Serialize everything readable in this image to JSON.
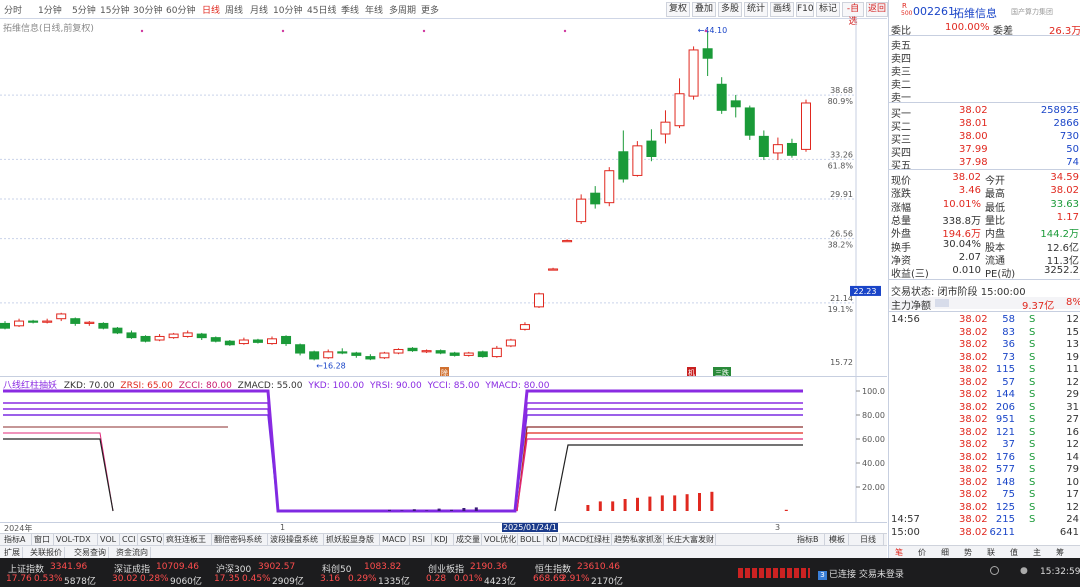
{
  "periods": [
    "分时",
    "1分钟",
    "5分钟",
    "15分钟",
    "30分钟",
    "60分钟",
    "日线",
    "周线",
    "月线",
    "10分钟",
    "45日线",
    "季线",
    "年线",
    "多周期",
    "更多"
  ],
  "active_period": "日线",
  "toolbar": [
    "复权",
    "叠加",
    "多股",
    "统计",
    "画线",
    "F10",
    "标记",
    "-自选",
    "返回"
  ],
  "chart": {
    "title": "拓维信息(日线,前复权)",
    "price_ticks": [
      "38.68",
      "33.26",
      "29.91",
      "26.56",
      "22.23",
      "21.14",
      "15.72"
    ],
    "pct_ticks": [
      "80.9%",
      "61.8%",
      "38.2%",
      "19.1%"
    ],
    "high_label": "44.10",
    "low_label": "16.28",
    "markers": [
      "除",
      "机",
      "三跌"
    ],
    "candles": [
      {
        "o": 19.4,
        "c": 19.0,
        "h": 19.6,
        "l": 18.9
      },
      {
        "o": 19.2,
        "c": 19.6,
        "h": 19.8,
        "l": 19.1
      },
      {
        "o": 19.6,
        "c": 19.5,
        "h": 19.7,
        "l": 19.4
      },
      {
        "o": 19.5,
        "c": 19.6,
        "h": 19.8,
        "l": 19.4
      },
      {
        "o": 19.8,
        "c": 20.2,
        "h": 20.3,
        "l": 19.6
      },
      {
        "o": 19.8,
        "c": 19.4,
        "h": 19.9,
        "l": 19.2
      },
      {
        "o": 19.4,
        "c": 19.5,
        "h": 19.6,
        "l": 19.2
      },
      {
        "o": 19.4,
        "c": 19.0,
        "h": 19.5,
        "l": 18.9
      },
      {
        "o": 19.0,
        "c": 18.6,
        "h": 19.1,
        "l": 18.5
      },
      {
        "o": 18.6,
        "c": 18.2,
        "h": 18.8,
        "l": 18.1
      },
      {
        "o": 18.3,
        "c": 17.9,
        "h": 18.4,
        "l": 17.8
      },
      {
        "o": 18.0,
        "c": 18.3,
        "h": 18.5,
        "l": 17.9
      },
      {
        "o": 18.2,
        "c": 18.5,
        "h": 18.6,
        "l": 18.1
      },
      {
        "o": 18.3,
        "c": 18.6,
        "h": 18.8,
        "l": 18.2
      },
      {
        "o": 18.5,
        "c": 18.2,
        "h": 18.6,
        "l": 18.0
      },
      {
        "o": 18.2,
        "c": 17.9,
        "h": 18.3,
        "l": 17.8
      },
      {
        "o": 17.9,
        "c": 17.6,
        "h": 18.0,
        "l": 17.5
      },
      {
        "o": 17.7,
        "c": 18.0,
        "h": 18.2,
        "l": 17.6
      },
      {
        "o": 18.0,
        "c": 17.8,
        "h": 18.1,
        "l": 17.7
      },
      {
        "o": 17.7,
        "c": 18.1,
        "h": 18.3,
        "l": 17.6
      },
      {
        "o": 18.3,
        "c": 17.7,
        "h": 18.4,
        "l": 17.5
      },
      {
        "o": 17.6,
        "c": 16.9,
        "h": 17.7,
        "l": 16.7
      },
      {
        "o": 17.0,
        "c": 16.4,
        "h": 17.1,
        "l": 16.28
      },
      {
        "o": 16.5,
        "c": 17.0,
        "h": 17.2,
        "l": 16.4
      },
      {
        "o": 17.0,
        "c": 16.9,
        "h": 17.3,
        "l": 16.8
      },
      {
        "o": 16.9,
        "c": 16.7,
        "h": 17.0,
        "l": 16.5
      },
      {
        "o": 16.6,
        "c": 16.4,
        "h": 16.8,
        "l": 16.3
      },
      {
        "o": 16.5,
        "c": 16.9,
        "h": 17.0,
        "l": 16.4
      },
      {
        "o": 16.9,
        "c": 17.2,
        "h": 17.3,
        "l": 16.8
      },
      {
        "o": 17.3,
        "c": 17.1,
        "h": 17.4,
        "l": 17.0
      },
      {
        "o": 17.0,
        "c": 17.1,
        "h": 17.2,
        "l": 16.9
      },
      {
        "o": 17.1,
        "c": 16.9,
        "h": 17.2,
        "l": 16.8
      },
      {
        "o": 16.9,
        "c": 16.7,
        "h": 17.0,
        "l": 16.6
      },
      {
        "o": 16.7,
        "c": 16.9,
        "h": 17.0,
        "l": 16.6
      },
      {
        "o": 17.0,
        "c": 16.6,
        "h": 17.1,
        "l": 16.5
      },
      {
        "o": 16.6,
        "c": 17.3,
        "h": 17.5,
        "l": 16.5
      },
      {
        "o": 17.5,
        "c": 18.0,
        "h": 18.1,
        "l": 17.4
      },
      {
        "o": 18.9,
        "c": 19.3,
        "h": 19.5,
        "l": 18.8
      },
      {
        "o": 20.8,
        "c": 21.9,
        "h": 22.0,
        "l": 20.7
      },
      {
        "o": 23.9,
        "c": 24.0,
        "h": 24.1,
        "l": 23.9
      },
      {
        "o": 26.3,
        "c": 26.4,
        "h": 26.5,
        "l": 26.3
      },
      {
        "o": 28.0,
        "c": 29.9,
        "h": 30.3,
        "l": 27.8
      },
      {
        "o": 30.4,
        "c": 29.5,
        "h": 31.0,
        "l": 29.1
      },
      {
        "o": 29.6,
        "c": 32.3,
        "h": 32.6,
        "l": 29.3
      },
      {
        "o": 33.9,
        "c": 31.6,
        "h": 35.7,
        "l": 31.3
      },
      {
        "o": 31.9,
        "c": 34.4,
        "h": 34.8,
        "l": 31.8
      },
      {
        "o": 34.8,
        "c": 33.5,
        "h": 35.8,
        "l": 33.1
      },
      {
        "o": 35.4,
        "c": 36.4,
        "h": 37.4,
        "l": 34.6
      },
      {
        "o": 36.1,
        "c": 38.8,
        "h": 40.1,
        "l": 35.9
      },
      {
        "o": 38.6,
        "c": 42.5,
        "h": 42.8,
        "l": 38.3
      },
      {
        "o": 42.6,
        "c": 41.8,
        "h": 44.1,
        "l": 40.3
      },
      {
        "o": 39.6,
        "c": 37.4,
        "h": 40.2,
        "l": 37.1
      },
      {
        "o": 38.2,
        "c": 37.7,
        "h": 38.7,
        "l": 36.8
      },
      {
        "o": 37.6,
        "c": 35.3,
        "h": 37.8,
        "l": 34.9
      },
      {
        "o": 35.2,
        "c": 33.5,
        "h": 35.7,
        "l": 33.2
      },
      {
        "o": 33.8,
        "c": 34.5,
        "h": 35.1,
        "l": 33.2
      },
      {
        "o": 34.6,
        "c": 33.6,
        "h": 35.0,
        "l": 33.4
      },
      {
        "o": 34.1,
        "c": 38.02,
        "h": 38.3,
        "l": 33.9
      }
    ]
  },
  "sub": {
    "title_name": "八线红柱抽妖",
    "params": [
      "ZKD: 70.00",
      "ZRSI: 65.00",
      "ZCCI: 80.00",
      "ZMACD: 55.00",
      "YKD: 100.00",
      "YRSI: 90.00",
      "YCCI: 85.00",
      "YMACD: 80.00"
    ],
    "ticks": [
      "100.0",
      "80.00",
      "60.00",
      "40.00",
      "20.00"
    ],
    "bars": [
      1,
      0.5,
      1.5,
      0.5,
      2,
      1,
      2.5,
      3,
      0,
      0,
      0,
      0,
      0,
      0,
      0,
      0,
      5,
      8,
      8,
      10,
      11,
      12,
      13,
      13,
      14,
      15,
      16,
      0,
      0,
      0,
      0,
      0,
      1
    ]
  },
  "dates": [
    "2024年",
    "1",
    "2025/01/24/1",
    "3"
  ],
  "ind_tabs": [
    "指标A",
    "窗口",
    "VOL-TDX",
    "VOL",
    "CCI",
    "GSTQ",
    "疯狂连板王",
    "翻倍密码系统",
    "波段操盘系统",
    "抓妖股显身版",
    "MACD",
    "RSI",
    "KDJ",
    "成交量",
    "VOL优化",
    "BOLL",
    "KD",
    "MACD红绿柱",
    "趋势私家抓涨",
    "长庄大富发财",
    "指标B",
    "模板",
    "日线"
  ],
  "func_tabs": [
    "扩展",
    "关联报价",
    "交易查询",
    "资金流向"
  ],
  "quote": {
    "code": "002261",
    "name": "拓维信息",
    "tag": "R",
    "tag_sub": "500",
    "subtitle": "国产算力集团",
    "weibi_label": "委比",
    "weibi": "100.00%",
    "weicha_label": "委差",
    "weicha": "26.3万",
    "sell": [
      [
        "卖五",
        "",
        ""
      ],
      [
        "卖四",
        "",
        ""
      ],
      [
        "卖三",
        "",
        ""
      ],
      [
        "卖二",
        "",
        ""
      ],
      [
        "卖一",
        "",
        ""
      ]
    ],
    "buy": [
      [
        "买一",
        "38.02",
        "258925"
      ],
      [
        "买二",
        "38.01",
        "2866"
      ],
      [
        "买三",
        "38.00",
        "730"
      ],
      [
        "买四",
        "37.99",
        "50"
      ],
      [
        "买五",
        "37.98",
        "74"
      ]
    ],
    "stats": [
      [
        "现价",
        "38.02",
        "今开",
        "34.59"
      ],
      [
        "涨跌",
        "3.46",
        "最高",
        "38.02"
      ],
      [
        "涨幅",
        "10.01%",
        "最低",
        "33.63"
      ],
      [
        "总量",
        "338.8万",
        "量比",
        "1.17"
      ],
      [
        "外盘",
        "194.6万",
        "内盘",
        "144.2万"
      ],
      [
        "换手",
        "30.04%",
        "股本",
        "12.6亿"
      ],
      [
        "净资",
        "2.07",
        "流通",
        "11.3亿"
      ],
      [
        "收益(三)",
        "0.010",
        "PE(动)",
        "3252.2"
      ]
    ],
    "trade_status": "交易状态: 闭市阶段 15:00:00",
    "main_flow_label": "主力净额",
    "main_flow": "9.37亿",
    "main_flow_pct": "8%",
    "ticks": [
      [
        "14:56",
        "38.02",
        "58",
        "S",
        "12"
      ],
      [
        "",
        "38.02",
        "83",
        "S",
        "15"
      ],
      [
        "",
        "38.02",
        "36",
        "S",
        "13"
      ],
      [
        "",
        "38.02",
        "73",
        "S",
        "19"
      ],
      [
        "",
        "38.02",
        "115",
        "S",
        "11"
      ],
      [
        "",
        "38.02",
        "57",
        "S",
        "12"
      ],
      [
        "",
        "38.02",
        "144",
        "S",
        "29"
      ],
      [
        "",
        "38.02",
        "206",
        "S",
        "31"
      ],
      [
        "",
        "38.02",
        "951",
        "S",
        "27"
      ],
      [
        "",
        "38.02",
        "121",
        "S",
        "16"
      ],
      [
        "",
        "38.02",
        "37",
        "S",
        "12"
      ],
      [
        "",
        "38.02",
        "176",
        "S",
        "14"
      ],
      [
        "",
        "38.02",
        "577",
        "S",
        "79"
      ],
      [
        "",
        "38.02",
        "148",
        "S",
        "10"
      ],
      [
        "",
        "38.02",
        "75",
        "S",
        "17"
      ],
      [
        "",
        "38.02",
        "125",
        "S",
        "12"
      ],
      [
        "14:57",
        "38.02",
        "215",
        "S",
        "24"
      ],
      [
        "15:00",
        "38.02",
        "6211",
        "",
        "641"
      ]
    ],
    "bottom_tabs": [
      "笔",
      "价",
      "细",
      "势",
      "联",
      "值",
      "主",
      "筹"
    ]
  },
  "status": {
    "indices": [
      {
        "name": "上证指数",
        "value": "3341.96",
        "chg": "17.76",
        "pct": "0.53%",
        "amt": "5878亿"
      },
      {
        "name": "深证成指",
        "value": "10709.46",
        "chg": "30.02",
        "pct": "0.28%",
        "amt": "9060亿"
      },
      {
        "name": "沪深300",
        "value": "3902.57",
        "chg": "17.35",
        "pct": "0.45%",
        "amt": "2909亿"
      },
      {
        "name": "科创50",
        "value": "1083.82",
        "chg": "3.16",
        "pct": "0.29%",
        "amt": "1335亿"
      },
      {
        "name": "创业板指",
        "value": "2190.36",
        "chg": "0.28",
        "pct": "0.01%",
        "amt": "4423亿"
      },
      {
        "name": "恒生指数",
        "value": "23610.46",
        "chg": "668.69",
        "pct": "2.91%",
        "amt": "2170亿"
      }
    ],
    "connection": "已连接 交易未登录",
    "time": "15:32:59"
  },
  "colors": {
    "up": "#e0281f",
    "down": "#1a9a38",
    "line_purple": "#8a2be2"
  }
}
